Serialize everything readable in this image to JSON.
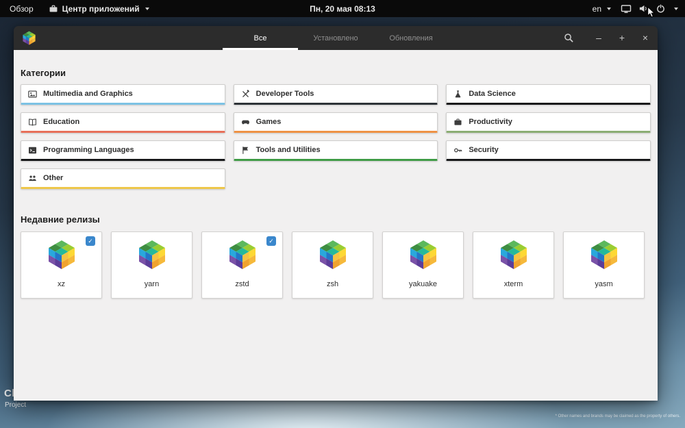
{
  "topbar": {
    "overview": "Обзор",
    "app_name": "Центр приложений",
    "clock": "Пн, 20 мая  08:13",
    "layout": "en"
  },
  "header": {
    "tabs": [
      {
        "label": "Все",
        "active": true
      },
      {
        "label": "Установлено",
        "active": false
      },
      {
        "label": "Обновления",
        "active": false
      }
    ],
    "controls": {
      "minimize": "–",
      "maximize": "+",
      "close": "×"
    }
  },
  "categories": {
    "title": "Категории",
    "items": [
      {
        "label": "Multimedia and Graphics",
        "accent": "#7cc2e4",
        "icon": "multimedia-icon"
      },
      {
        "label": "Developer Tools",
        "accent": "#2e3338",
        "icon": "developer-tools-icon"
      },
      {
        "label": "Data Science",
        "accent": "#17181a",
        "icon": "data-science-icon"
      },
      {
        "label": "Education",
        "accent": "#e8705a",
        "icon": "education-icon"
      },
      {
        "label": "Games",
        "accent": "#ef9245",
        "icon": "games-icon"
      },
      {
        "label": "Productivity",
        "accent": "#8cae74",
        "icon": "productivity-icon"
      },
      {
        "label": "Programming Languages",
        "accent": "#17181a",
        "icon": "programming-icon"
      },
      {
        "label": "Tools and Utilities",
        "accent": "#3f9c46",
        "icon": "tools-icon"
      },
      {
        "label": "Security",
        "accent": "#17181a",
        "icon": "security-icon"
      },
      {
        "label": "Other",
        "accent": "#eec74a",
        "icon": "other-icon"
      }
    ]
  },
  "recent": {
    "title": "Недавние релизы",
    "apps": [
      {
        "name": "xz",
        "badge": true
      },
      {
        "name": "yarn",
        "badge": false
      },
      {
        "name": "zstd",
        "badge": true
      },
      {
        "name": "zsh",
        "badge": false
      },
      {
        "name": "yakuake",
        "badge": false
      },
      {
        "name": "xterm",
        "badge": false
      },
      {
        "name": "yasm",
        "badge": false
      }
    ],
    "badge_glyph": "✓"
  },
  "desktop": {
    "wallpaper_title": "Clear",
    "wallpaper_subtitle": "Project",
    "footnote": "* Other names and brands may be claimed as the property of others."
  },
  "icons": {
    "topbar": [
      "briefcase-icon",
      "display-icon",
      "speaker-icon",
      "power-icon",
      "dropdown-caret-icon"
    ],
    "headerbar": [
      "app-cube-icon",
      "search-icon"
    ],
    "badge": "update-check-badge"
  }
}
